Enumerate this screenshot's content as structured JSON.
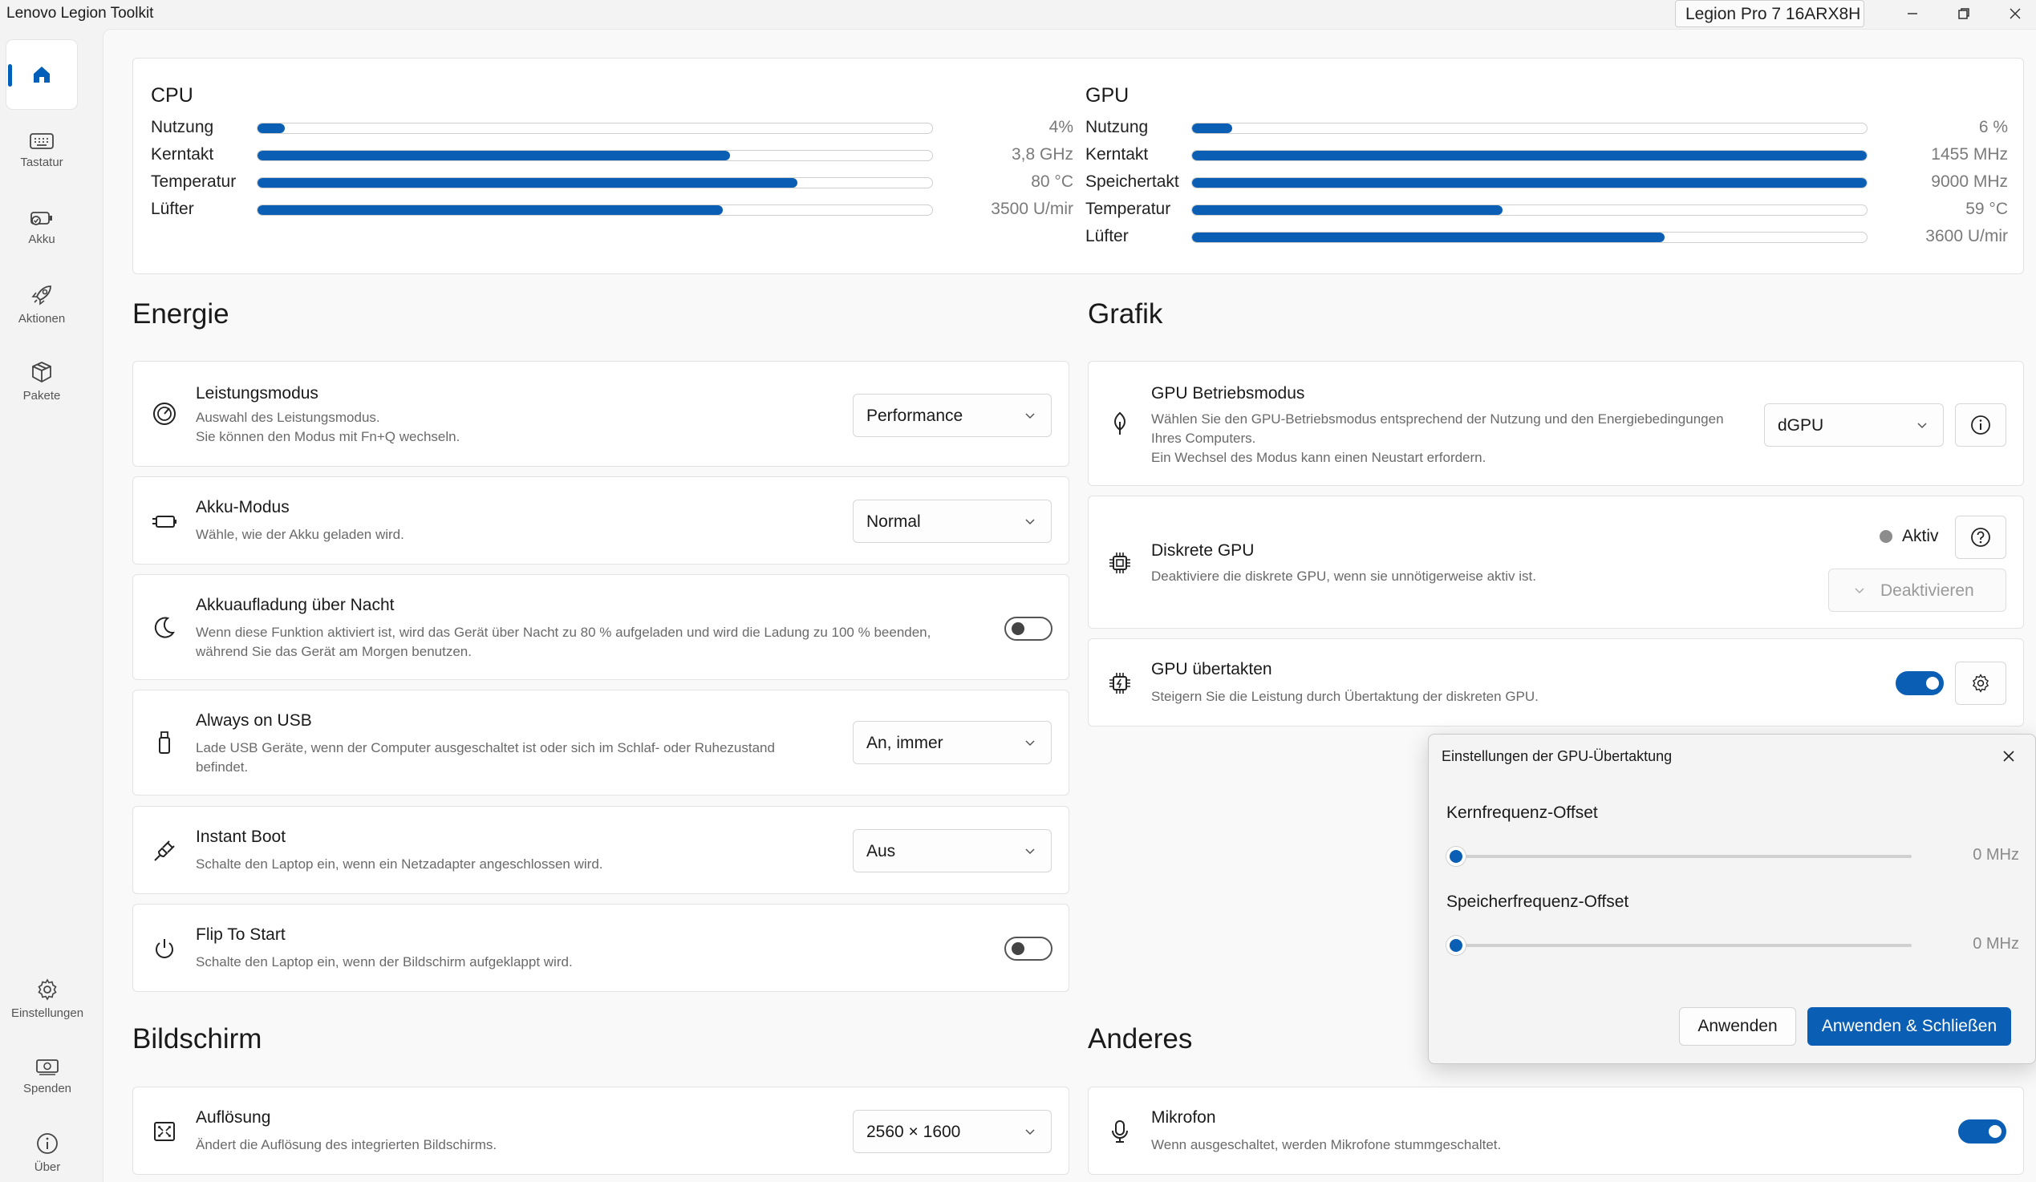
{
  "window": {
    "title": "Lenovo Legion Toolkit",
    "device": "Legion Pro 7 16ARX8H"
  },
  "sidebar": {
    "items": [
      {
        "label": "",
        "icon": "home-icon",
        "active": true
      },
      {
        "label": "Tastatur",
        "icon": "keyboard-icon"
      },
      {
        "label": "Akku",
        "icon": "battery-icon"
      },
      {
        "label": "Aktionen",
        "icon": "rocket-icon"
      },
      {
        "label": "Pakete",
        "icon": "package-icon"
      },
      {
        "label": "Einstellungen",
        "icon": "gear-icon"
      },
      {
        "label": "Spenden",
        "icon": "money-icon"
      },
      {
        "label": "Über",
        "icon": "info-icon"
      }
    ]
  },
  "sensors": {
    "cpu": {
      "title": "CPU",
      "rows": [
        {
          "label": "Nutzung",
          "value": "4%",
          "level": 0.04
        },
        {
          "label": "Kerntakt",
          "value": "3,8 GHz",
          "level": 0.7
        },
        {
          "label": "Temperatur",
          "value": "80 °C",
          "level": 0.8
        },
        {
          "label": "Lüfter",
          "value": "3500 U/mir",
          "level": 0.69
        }
      ]
    },
    "gpu": {
      "title": "GPU",
      "rows": [
        {
          "label": "Nutzung",
          "value": "6 %",
          "level": 0.06
        },
        {
          "label": "Kerntakt",
          "value": "1455 MHz",
          "level": 1.0
        },
        {
          "label": "Speichertakt",
          "value": "9000 MHz",
          "level": 1.0
        },
        {
          "label": "Temperatur",
          "value": "59 °C",
          "level": 0.46
        },
        {
          "label": "Lüfter",
          "value": "3600 U/mir",
          "level": 0.7
        }
      ]
    }
  },
  "energy": {
    "heading": "Energie",
    "power_mode": {
      "title": "Leistungsmodus",
      "desc1": "Auswahl des Leistungsmodus.",
      "desc2": "Sie können den Modus mit Fn+Q wechseln.",
      "value": "Performance"
    },
    "battery_mode": {
      "title": "Akku-Modus",
      "desc": "Wähle, wie der Akku geladen wird.",
      "value": "Normal"
    },
    "overnight": {
      "title": "Akkuaufladung über Nacht",
      "desc1": "Wenn diese Funktion aktiviert ist, wird das Gerät über Nacht zu 80 % aufgeladen und wird die Ladung zu 100 % beenden,",
      "desc2": "während Sie das Gerät am Morgen benutzen.",
      "on": false
    },
    "usb": {
      "title": "Always on USB",
      "desc1": "Lade USB Geräte, wenn der Computer ausgeschaltet ist oder sich im Schlaf- oder Ruhezustand",
      "desc2": "befindet.",
      "value": "An, immer"
    },
    "instant_boot": {
      "title": "Instant Boot",
      "desc": "Schalte den Laptop ein, wenn ein Netzadapter angeschlossen wird.",
      "value": "Aus"
    },
    "flip": {
      "title": "Flip To Start",
      "desc": "Schalte den Laptop ein, wenn der Bildschirm aufgeklappt wird.",
      "on": false
    }
  },
  "graphics": {
    "heading": "Grafik",
    "gpu_mode": {
      "title": "GPU Betriebsmodus",
      "desc1": "Wählen Sie den GPU-Betriebsmodus entsprechend der Nutzung und den Energiebedingungen",
      "desc2": "Ihres Computers.",
      "desc3": "Ein Wechsel des Modus kann einen Neustart erfordern.",
      "value": "dGPU"
    },
    "dgpu": {
      "title": "Diskrete GPU",
      "desc": "Deaktiviere die diskrete GPU, wenn sie unnötigerweise aktiv ist.",
      "status": "Aktiv",
      "button": "Deaktivieren"
    },
    "oc": {
      "title": "GPU übertakten",
      "desc": "Steigern Sie die Leistung durch Übertaktung der diskreten GPU.",
      "on": true
    }
  },
  "popup": {
    "title": "Einstellungen der GPU-Übertaktung",
    "core_label": "Kernfrequenz-Offset",
    "core_value": "0 MHz",
    "mem_label": "Speicherfrequenz-Offset",
    "mem_value": "0 MHz",
    "apply": "Anwenden",
    "apply_close": "Anwenden & Schließen"
  },
  "display": {
    "heading": "Bildschirm",
    "resolution": {
      "title": "Auflösung",
      "desc": "Ändert die Auflösung des integrierten Bildschirms.",
      "value": "2560 × 1600"
    }
  },
  "other": {
    "heading": "Anderes",
    "mic": {
      "title": "Mikrofon",
      "desc": "Wenn ausgeschaltet, werden Mikrofone stummgeschaltet.",
      "on": true
    }
  },
  "colors": {
    "accent": "#0a5fb5"
  }
}
